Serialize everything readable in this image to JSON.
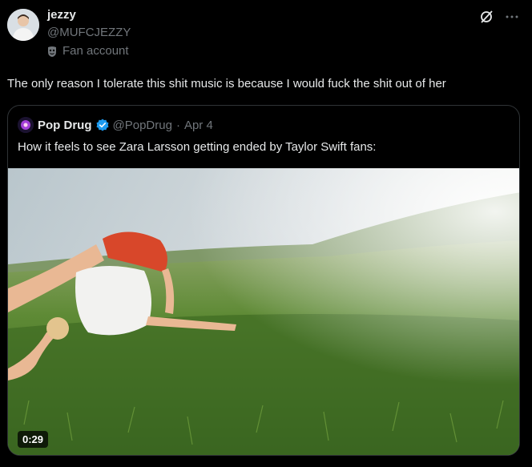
{
  "tweet": {
    "author_name": "jezzy",
    "author_handle": "@MUFCJEZZY",
    "fan_label": "Fan account",
    "text": "The only reason I tolerate this shit music is because I would fuck the shit out of her"
  },
  "quote": {
    "author_name": "Pop Drug",
    "author_handle": "@PopDrug",
    "separator": "·",
    "date": "Apr 4",
    "text": "How it feels to see Zara Larsson getting ended by Taylor Swift fans:",
    "video_duration": "0:29"
  },
  "colors": {
    "background": "#000000",
    "text_primary": "#e7e9ea",
    "text_secondary": "#71767b",
    "verified_badge": "#1d9bf0",
    "border": "#2f3336"
  },
  "icons": [
    "grok-icon",
    "more-icon",
    "fan-mask-icon",
    "verified-badge-icon"
  ]
}
